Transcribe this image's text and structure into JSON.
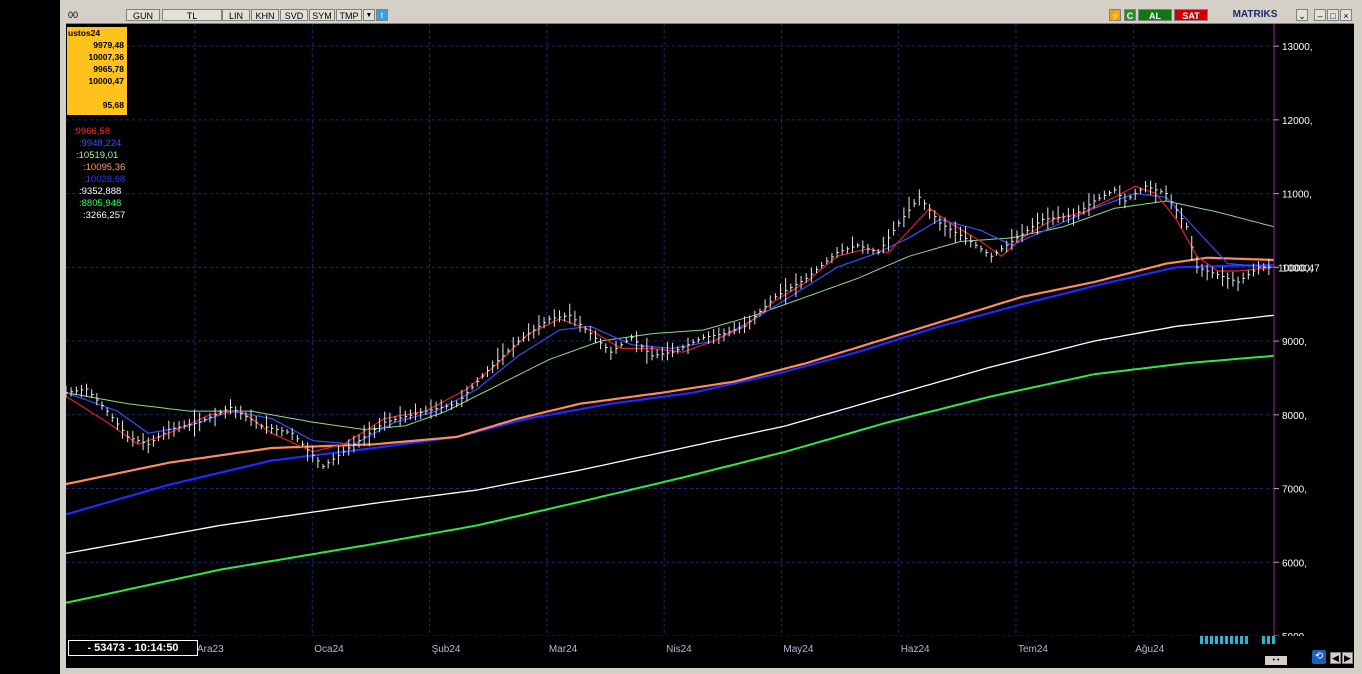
{
  "toolbar": {
    "left_text": "00",
    "buttons": [
      "GUN",
      "TL",
      "LIN",
      "KHN",
      "SVD",
      "SYM",
      "TMP"
    ],
    "dropdown_icon": "triangle-down-icon",
    "twitter_icon": "twitter-bird-icon",
    "right": {
      "edit_icon": "lightning-icon",
      "refresh_icon": "refresh-c-icon",
      "buy_label": "AL",
      "sell_label": "SAT",
      "brand": "MATRIKS"
    }
  },
  "ohlc": {
    "title": "ustos24",
    "open": "9979,48",
    "high": "10007,36",
    "low": "9965,78",
    "close": "10000,47",
    "volume": "95,68"
  },
  "indicators": [
    {
      "label": ":9966,58",
      "color": "#ff2a2a"
    },
    {
      "label": ":9948,224",
      "color": "#3355ff"
    },
    {
      "label": ":10519,01",
      "color": "#9cff9c"
    },
    {
      "label": ":10095,36",
      "color": "#ff9966"
    },
    {
      "label": ":10028,68",
      "color": "#2040ff"
    },
    {
      "label": ":9352,888",
      "color": "#ffffff"
    },
    {
      "label": ":8805,948",
      "color": "#33ff55"
    },
    {
      "label": ":3266,257",
      "color": "#ffffff"
    }
  ],
  "status": {
    "time_label": "- 53473 - 10:14:50"
  },
  "chart_data": {
    "type": "line",
    "price_label": "10000,47",
    "ylim": [
      5000,
      13300
    ],
    "yticks": [
      {
        "value": 5000,
        "label": "5000,"
      },
      {
        "value": 6000,
        "label": "6000,"
      },
      {
        "value": 7000,
        "label": "7000,"
      },
      {
        "value": 8000,
        "label": "8000,"
      },
      {
        "value": 9000,
        "label": "9000,"
      },
      {
        "value": 10000,
        "label": "10000,"
      },
      {
        "value": 11000,
        "label": "11000,"
      },
      {
        "value": 12000,
        "label": "12000,"
      },
      {
        "value": 13000,
        "label": "13000,"
      }
    ],
    "xlabels": [
      "Ara23",
      "Oca24",
      "Şub24",
      "Mar24",
      "Nis24",
      "May24",
      "Haz24",
      "Tem24",
      "Ağu24"
    ],
    "xlabel_index": [
      22,
      42,
      62,
      82,
      102,
      122,
      142,
      162,
      182
    ],
    "n": 206,
    "anchors": {
      "price": [
        [
          0,
          8300
        ],
        [
          4,
          8350
        ],
        [
          8,
          8050
        ],
        [
          12,
          7700
        ],
        [
          16,
          7600
        ],
        [
          20,
          7800
        ],
        [
          26,
          7900
        ],
        [
          32,
          8100
        ],
        [
          38,
          7850
        ],
        [
          44,
          7750
        ],
        [
          50,
          7300
        ],
        [
          56,
          7600
        ],
        [
          62,
          7900
        ],
        [
          70,
          8050
        ],
        [
          76,
          8150
        ],
        [
          82,
          8600
        ],
        [
          88,
          9000
        ],
        [
          94,
          9300
        ],
        [
          98,
          9350
        ],
        [
          102,
          9100
        ],
        [
          106,
          8850
        ],
        [
          110,
          9050
        ],
        [
          114,
          8800
        ],
        [
          118,
          8850
        ],
        [
          124,
          9050
        ],
        [
          128,
          9100
        ],
        [
          132,
          9200
        ],
        [
          138,
          9600
        ],
        [
          144,
          9850
        ],
        [
          150,
          10200
        ],
        [
          154,
          10300
        ],
        [
          158,
          10200
        ],
        [
          162,
          10600
        ],
        [
          166,
          10950
        ],
        [
          170,
          10600
        ],
        [
          176,
          10350
        ],
        [
          180,
          10150
        ],
        [
          184,
          10350
        ],
        [
          190,
          10650
        ],
        [
          196,
          10700
        ],
        [
          200,
          10900
        ],
        [
          204,
          11050
        ],
        [
          206,
          10900
        ],
        [
          210,
          11100
        ],
        [
          214,
          11000
        ],
        [
          218,
          10550
        ],
        [
          220,
          10000
        ],
        [
          224,
          9900
        ],
        [
          228,
          9800
        ],
        [
          232,
          10000
        ],
        [
          235,
          10000
        ]
      ],
      "ma_red": [
        [
          0,
          8250
        ],
        [
          8,
          7900
        ],
        [
          14,
          7600
        ],
        [
          20,
          7750
        ],
        [
          28,
          8000
        ],
        [
          34,
          8050
        ],
        [
          40,
          7750
        ],
        [
          48,
          7500
        ],
        [
          54,
          7600
        ],
        [
          62,
          7950
        ],
        [
          70,
          8050
        ],
        [
          78,
          8350
        ],
        [
          84,
          8700
        ],
        [
          90,
          9100
        ],
        [
          96,
          9300
        ],
        [
          102,
          9150
        ],
        [
          108,
          8900
        ],
        [
          114,
          8900
        ],
        [
          120,
          8850
        ],
        [
          126,
          9000
        ],
        [
          132,
          9200
        ],
        [
          138,
          9550
        ],
        [
          144,
          9800
        ],
        [
          150,
          10150
        ],
        [
          156,
          10250
        ],
        [
          160,
          10200
        ],
        [
          164,
          10500
        ],
        [
          168,
          10800
        ],
        [
          172,
          10600
        ],
        [
          178,
          10350
        ],
        [
          182,
          10150
        ],
        [
          186,
          10400
        ],
        [
          192,
          10650
        ],
        [
          198,
          10750
        ],
        [
          204,
          10950
        ],
        [
          208,
          11100
        ],
        [
          212,
          11000
        ],
        [
          216,
          10650
        ],
        [
          220,
          10150
        ],
        [
          224,
          9950
        ],
        [
          228,
          9950
        ],
        [
          235,
          10000
        ]
      ],
      "ma_blue": [
        [
          0,
          8300
        ],
        [
          10,
          8050
        ],
        [
          16,
          7750
        ],
        [
          24,
          7850
        ],
        [
          32,
          8050
        ],
        [
          40,
          7950
        ],
        [
          48,
          7650
        ],
        [
          56,
          7600
        ],
        [
          64,
          7900
        ],
        [
          72,
          8050
        ],
        [
          80,
          8350
        ],
        [
          88,
          8800
        ],
        [
          96,
          9150
        ],
        [
          102,
          9200
        ],
        [
          110,
          8950
        ],
        [
          118,
          8900
        ],
        [
          126,
          9000
        ],
        [
          134,
          9300
        ],
        [
          142,
          9650
        ],
        [
          150,
          10000
        ],
        [
          158,
          10200
        ],
        [
          164,
          10400
        ],
        [
          170,
          10650
        ],
        [
          178,
          10500
        ],
        [
          184,
          10300
        ],
        [
          192,
          10550
        ],
        [
          200,
          10800
        ],
        [
          208,
          11000
        ],
        [
          214,
          10950
        ],
        [
          220,
          10500
        ],
        [
          226,
          10050
        ],
        [
          235,
          10000
        ]
      ],
      "ma_lightgreen": [
        [
          0,
          8300
        ],
        [
          12,
          8150
        ],
        [
          24,
          8050
        ],
        [
          36,
          8050
        ],
        [
          48,
          7900
        ],
        [
          58,
          7800
        ],
        [
          66,
          7850
        ],
        [
          74,
          8050
        ],
        [
          84,
          8400
        ],
        [
          94,
          8750
        ],
        [
          104,
          9000
        ],
        [
          114,
          9100
        ],
        [
          124,
          9150
        ],
        [
          134,
          9350
        ],
        [
          144,
          9600
        ],
        [
          154,
          9850
        ],
        [
          164,
          10150
        ],
        [
          174,
          10350
        ],
        [
          184,
          10400
        ],
        [
          194,
          10550
        ],
        [
          204,
          10800
        ],
        [
          214,
          10900
        ],
        [
          224,
          10750
        ],
        [
          235,
          10550
        ]
      ],
      "ma_orange": [
        [
          0,
          7060
        ],
        [
          20,
          7350
        ],
        [
          40,
          7550
        ],
        [
          60,
          7600
        ],
        [
          76,
          7700
        ],
        [
          88,
          7950
        ],
        [
          100,
          8150
        ],
        [
          116,
          8300
        ],
        [
          130,
          8450
        ],
        [
          144,
          8700
        ],
        [
          158,
          9000
        ],
        [
          172,
          9300
        ],
        [
          186,
          9600
        ],
        [
          200,
          9800
        ],
        [
          214,
          10050
        ],
        [
          222,
          10130
        ],
        [
          235,
          10100
        ]
      ],
      "ma_darkblue": [
        [
          0,
          6650
        ],
        [
          20,
          7050
        ],
        [
          40,
          7380
        ],
        [
          60,
          7550
        ],
        [
          76,
          7700
        ],
        [
          90,
          7950
        ],
        [
          106,
          8150
        ],
        [
          122,
          8300
        ],
        [
          138,
          8550
        ],
        [
          154,
          8850
        ],
        [
          170,
          9200
        ],
        [
          186,
          9500
        ],
        [
          202,
          9780
        ],
        [
          216,
          10000
        ],
        [
          226,
          10020
        ],
        [
          235,
          10030
        ]
      ],
      "ma_white": [
        [
          0,
          6120
        ],
        [
          30,
          6500
        ],
        [
          60,
          6800
        ],
        [
          80,
          6980
        ],
        [
          100,
          7250
        ],
        [
          120,
          7550
        ],
        [
          140,
          7850
        ],
        [
          160,
          8250
        ],
        [
          180,
          8650
        ],
        [
          200,
          9000
        ],
        [
          216,
          9200
        ],
        [
          235,
          9350
        ]
      ],
      "ma_green": [
        [
          0,
          5450
        ],
        [
          30,
          5900
        ],
        [
          60,
          6250
        ],
        [
          80,
          6500
        ],
        [
          100,
          6820
        ],
        [
          120,
          7150
        ],
        [
          140,
          7500
        ],
        [
          160,
          7900
        ],
        [
          180,
          8250
        ],
        [
          200,
          8550
        ],
        [
          218,
          8700
        ],
        [
          235,
          8800
        ]
      ]
    }
  }
}
